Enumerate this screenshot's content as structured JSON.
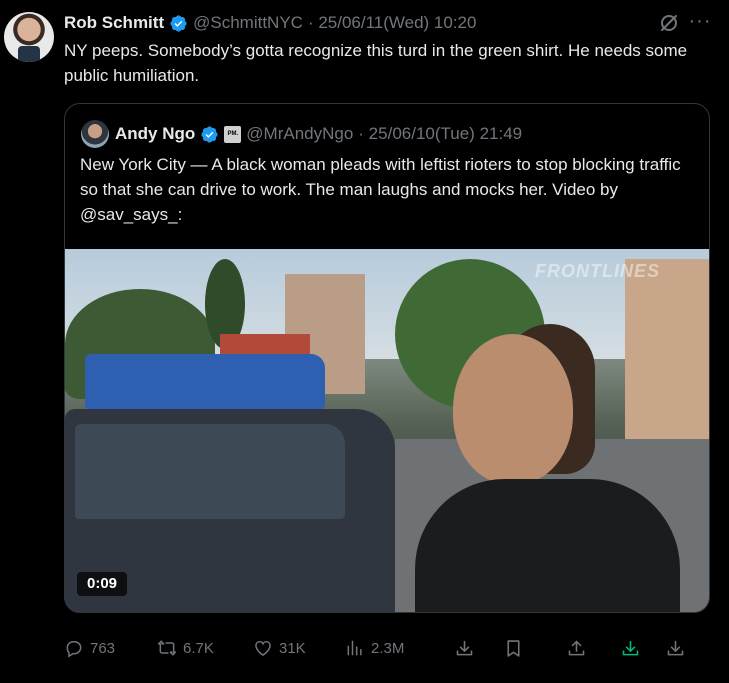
{
  "tweet": {
    "author_name": "Rob Schmitt",
    "author_handle": "@SchmittNYC",
    "timestamp": "· 25/06/11(Wed) 10:20",
    "text": "NY peeps.  Somebody’s gotta recognize this turd in the green shirt.  He needs some public humiliation."
  },
  "quote": {
    "author_name": "Andy Ngo",
    "affiliate_badge": "PM.",
    "author_handle": "@MrAndyNgo",
    "timestamp": "· 25/06/10(Tue) 21:49",
    "text": "New York City — A black woman pleads with leftist rioters to stop blocking traffic so that she can drive to work. The man laughs and mocks her. Video by @sav_says_:",
    "video": {
      "duration": "0:09",
      "watermark": "FRONTLINES"
    }
  },
  "actions": {
    "replies": "763",
    "reposts": "6.7K",
    "likes": "31K",
    "views": "2.3M"
  },
  "colors": {
    "background": "#000000",
    "text": "#e7e9ea",
    "muted": "#71767b",
    "verified": "#1d9bf0",
    "download_accent": "#00ba7c"
  }
}
